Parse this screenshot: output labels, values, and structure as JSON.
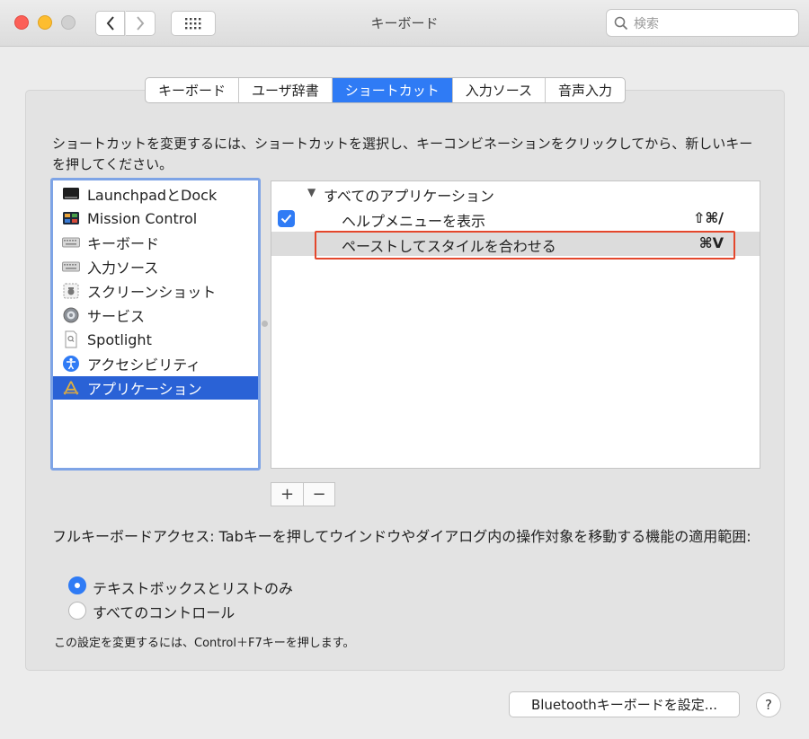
{
  "window": {
    "title": "キーボード"
  },
  "search": {
    "placeholder": "検索"
  },
  "tabs": [
    {
      "label": "キーボード"
    },
    {
      "label": "ユーザ辞書"
    },
    {
      "label": "ショートカット",
      "selected": true
    },
    {
      "label": "入力ソース"
    },
    {
      "label": "音声入力"
    }
  ],
  "instruction": "ショートカットを変更するには、ショートカットを選択し、キーコンビネーションをクリックしてから、新しいキーを押してください。",
  "categories": [
    {
      "label": "LaunchpadとDock",
      "icon": "launchpad-icon"
    },
    {
      "label": "Mission Control",
      "icon": "mission-control-icon"
    },
    {
      "label": "キーボード",
      "icon": "keyboard-icon"
    },
    {
      "label": "入力ソース",
      "icon": "keyboard-icon"
    },
    {
      "label": "スクリーンショット",
      "icon": "screenshot-icon"
    },
    {
      "label": "サービス",
      "icon": "gear-icon"
    },
    {
      "label": "Spotlight",
      "icon": "spotlight-icon"
    },
    {
      "label": "アクセシビリティ",
      "icon": "accessibility-icon"
    },
    {
      "label": "アプリケーション",
      "icon": "applications-icon",
      "selected": true
    }
  ],
  "shortcuts": {
    "group": "すべてのアプリケーション",
    "items": [
      {
        "label": "ヘルプメニューを表示",
        "key": "⇧⌘/",
        "checked": true
      },
      {
        "label": "ペーストしてスタイルを合わせる",
        "key": "⌘V",
        "selected": true
      }
    ]
  },
  "buttons": {
    "add": "+",
    "remove": "−"
  },
  "full_keyboard_access": {
    "label": "フルキーボードアクセス: Tabキーを押してウインドウやダイアログ内の操作対象を移動する機能の適用範囲:",
    "options": [
      {
        "label": "テキストボックスとリストのみ",
        "selected": true
      },
      {
        "label": "すべてのコントロール",
        "selected": false
      }
    ],
    "note": "この設定を変更するには、Control＋F7キーを押します。"
  },
  "footer": {
    "bluetooth_button": "Bluetoothキーボードを設定...",
    "help_button": "?"
  },
  "colors": {
    "accent": "#2f7bf5",
    "selection": "#2a62d6",
    "highlight_border": "#e4472c"
  }
}
